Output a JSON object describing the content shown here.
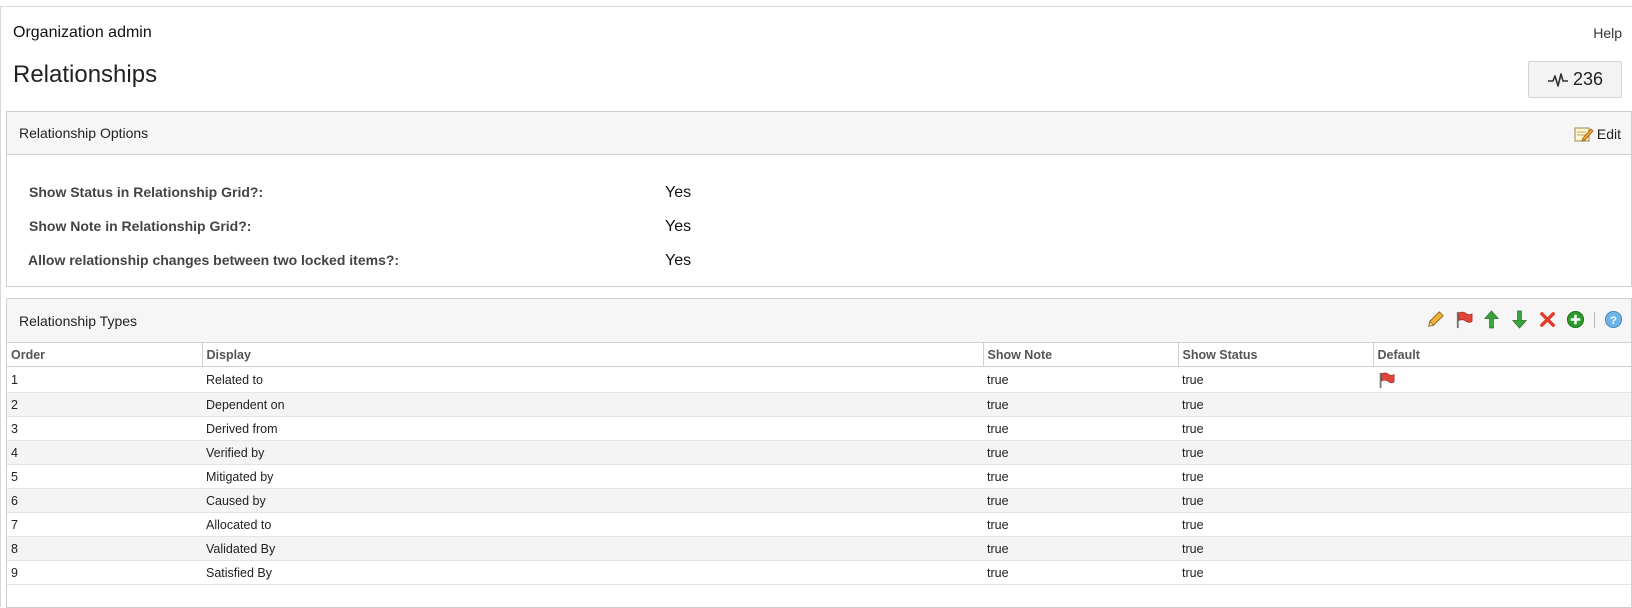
{
  "header": {
    "breadcrumb": "Organization admin",
    "help": "Help",
    "title": "Relationships",
    "activity_count": "236"
  },
  "options_panel": {
    "title": "Relationship Options",
    "edit_label": "Edit",
    "rows": [
      {
        "label": "Show Status in Relationship Grid?:",
        "value": "Yes"
      },
      {
        "label": "Show Note in Relationship Grid?:",
        "value": "Yes"
      },
      {
        "label": "Allow relationship changes between two locked items?:",
        "value": "Yes"
      }
    ]
  },
  "types_panel": {
    "title": "Relationship Types",
    "columns": [
      "Order",
      "Display",
      "Show Note",
      "Show Status",
      "Default"
    ],
    "rows": [
      {
        "order": "1",
        "display": "Related to",
        "show_note": "true",
        "show_status": "true",
        "default": true
      },
      {
        "order": "2",
        "display": "Dependent on",
        "show_note": "true",
        "show_status": "true",
        "default": false
      },
      {
        "order": "3",
        "display": "Derived from",
        "show_note": "true",
        "show_status": "true",
        "default": false
      },
      {
        "order": "4",
        "display": "Verified by",
        "show_note": "true",
        "show_status": "true",
        "default": false
      },
      {
        "order": "5",
        "display": "Mitigated by",
        "show_note": "true",
        "show_status": "true",
        "default": false
      },
      {
        "order": "6",
        "display": "Caused by",
        "show_note": "true",
        "show_status": "true",
        "default": false
      },
      {
        "order": "7",
        "display": "Allocated to",
        "show_note": "true",
        "show_status": "true",
        "default": false
      },
      {
        "order": "8",
        "display": "Validated By",
        "show_note": "true",
        "show_status": "true",
        "default": false
      },
      {
        "order": "9",
        "display": "Satisfied By",
        "show_note": "true",
        "show_status": "true",
        "default": false
      }
    ],
    "toolbar_icons": [
      "pencil-icon",
      "flag-icon",
      "arrow-up-icon",
      "arrow-down-icon",
      "delete-icon",
      "add-icon",
      "help-icon"
    ]
  },
  "colors": {
    "flag": "#e0463c",
    "up": "#3aa53a",
    "down": "#3aa53a",
    "delete": "#e33b2b",
    "add": "#2b9a2b",
    "help": "#4a9bd8"
  }
}
